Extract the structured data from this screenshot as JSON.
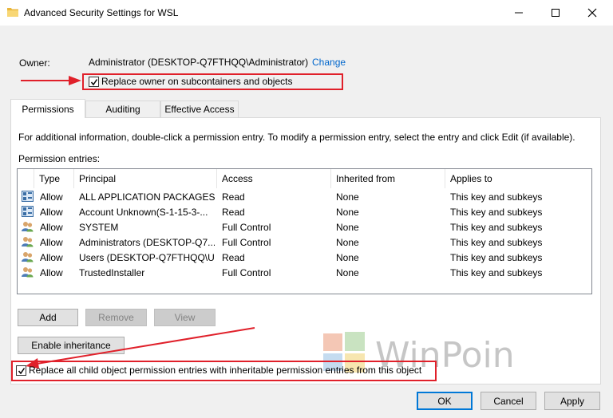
{
  "window": {
    "title": "Advanced Security Settings for WSL"
  },
  "owner": {
    "label": "Owner:",
    "value": "Administrator (DESKTOP-Q7FTHQQ\\Administrator)",
    "change_link": "Change",
    "replace_owner_checkbox": {
      "label": "Replace owner on subcontainers and objects",
      "checked": true
    }
  },
  "tabs": [
    {
      "label": "Permissions",
      "active": true
    },
    {
      "label": "Auditing",
      "active": false
    },
    {
      "label": "Effective Access",
      "active": false
    }
  ],
  "permissions": {
    "info_text": "For additional information, double-click a permission entry. To modify a permission entry, select the entry and click Edit (if available).",
    "entries_label": "Permission entries:",
    "columns": [
      "Type",
      "Principal",
      "Access",
      "Inherited from",
      "Applies to"
    ],
    "rows": [
      {
        "icon": "package-group-icon",
        "type": "Allow",
        "principal": "ALL APPLICATION PACKAGES",
        "access": "Read",
        "inherited_from": "None",
        "applies_to": "This key and subkeys"
      },
      {
        "icon": "package-group-icon",
        "type": "Allow",
        "principal": "Account Unknown(S-1-15-3-...",
        "access": "Read",
        "inherited_from": "None",
        "applies_to": "This key and subkeys"
      },
      {
        "icon": "users-icon",
        "type": "Allow",
        "principal": "SYSTEM",
        "access": "Full Control",
        "inherited_from": "None",
        "applies_to": "This key and subkeys"
      },
      {
        "icon": "users-icon",
        "type": "Allow",
        "principal": "Administrators (DESKTOP-Q7...",
        "access": "Full Control",
        "inherited_from": "None",
        "applies_to": "This key and subkeys"
      },
      {
        "icon": "users-icon",
        "type": "Allow",
        "principal": "Users (DESKTOP-Q7FTHQQ\\U...",
        "access": "Read",
        "inherited_from": "None",
        "applies_to": "This key and subkeys"
      },
      {
        "icon": "users-icon",
        "type": "Allow",
        "principal": "TrustedInstaller",
        "access": "Full Control",
        "inherited_from": "None",
        "applies_to": "This key and subkeys"
      }
    ],
    "buttons": {
      "add": "Add",
      "remove": "Remove",
      "view": "View"
    },
    "enable_inheritance": "Enable inheritance",
    "replace_child_checkbox": {
      "label": "Replace all child object permission entries with inheritable permission entries from this object",
      "checked": true
    }
  },
  "footer": {
    "ok": "OK",
    "cancel": "Cancel",
    "apply": "Apply"
  },
  "watermark": {
    "text": "WinPoin"
  },
  "colors": {
    "annotation_red": "#e0202a",
    "link_blue": "#0066cc",
    "focus_blue": "#0078d7"
  }
}
